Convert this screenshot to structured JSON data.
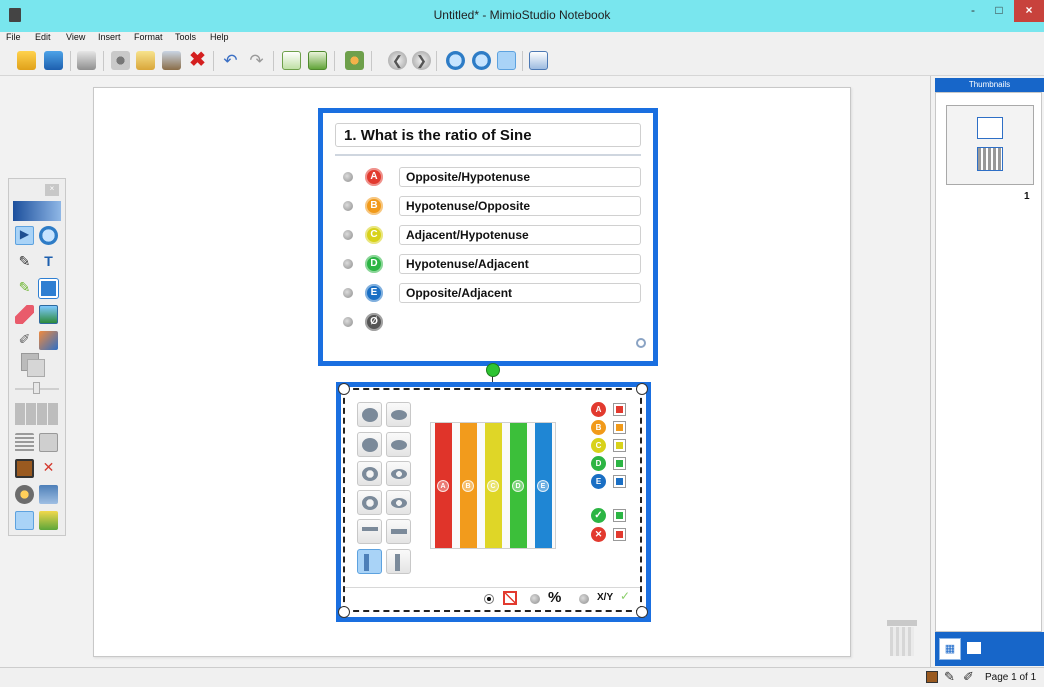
{
  "window": {
    "title": "Untitled* - MimioStudio Notebook",
    "minimize": "-",
    "maximize": "□",
    "close": "×"
  },
  "menu": [
    "File",
    "Edit",
    "View",
    "Insert",
    "Format",
    "Tools",
    "Help"
  ],
  "toolbar_icons": [
    "open-icon",
    "save-icon",
    "print-icon",
    "cut-icon",
    "copy-icon",
    "paste-icon",
    "delete-icon",
    "undo-icon",
    "redo-icon",
    "new-page-icon",
    "duplicate-page-icon",
    "group-icon",
    "previous-page-icon",
    "next-page-icon",
    "zoom-in-icon",
    "zoom-out-icon",
    "zoom-fit-icon",
    "view-mode-icon"
  ],
  "question": {
    "number": "1.",
    "text": "What is the ratio of Sine",
    "answers": [
      {
        "letter": "A",
        "text": "Opposite/Hypotenuse",
        "color": "#e23a2f"
      },
      {
        "letter": "B",
        "text": "Hypotenuse/Opposite",
        "color": "#f19a1a"
      },
      {
        "letter": "C",
        "text": "Adjacent/Hypotenuse",
        "color": "#d8d21a"
      },
      {
        "letter": "D",
        "text": "Hypotenuse/Adjacent",
        "color": "#2cb544"
      },
      {
        "letter": "E",
        "text": "Opposite/Adjacent",
        "color": "#1a6fc4"
      }
    ],
    "no_answer_symbol": "Ø"
  },
  "results_chart": {
    "bars": [
      {
        "label": "A",
        "color": "#e0342a"
      },
      {
        "label": "B",
        "color": "#f29b1c"
      },
      {
        "label": "C",
        "color": "#dfd627"
      },
      {
        "label": "D",
        "color": "#3cbf3a"
      },
      {
        "label": "E",
        "color": "#1f86d4"
      }
    ],
    "legend": [
      {
        "label": "A",
        "color": "#e23a2f"
      },
      {
        "label": "B",
        "color": "#f19a1a"
      },
      {
        "label": "C",
        "color": "#d8d21a"
      },
      {
        "label": "D",
        "color": "#2cb544"
      },
      {
        "label": "E",
        "color": "#1a6fc4"
      }
    ],
    "correct_symbol": "✓",
    "incorrect_symbol": "✕",
    "options": {
      "percent": "%",
      "ratio": "X/Y",
      "check": "✓"
    }
  },
  "thumbnails": {
    "header": "Thumbnails",
    "page_number": "1"
  },
  "status": {
    "page_label": "Page 1 of 1"
  }
}
